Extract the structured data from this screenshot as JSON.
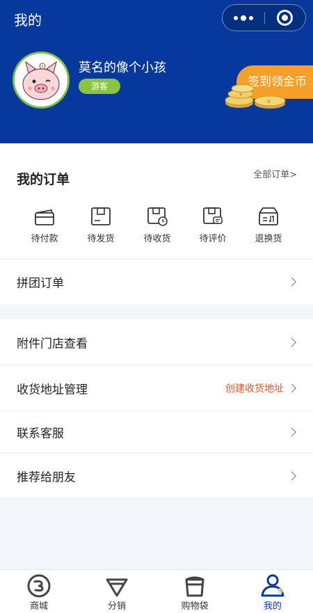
{
  "header": {
    "title": "我的",
    "capsule": {
      "more_icon": "more-dots-icon",
      "close_icon": "target-icon"
    }
  },
  "user": {
    "name": "莫名的像个小孩",
    "role": "游客",
    "avatar_icon": "pig-avatar"
  },
  "signin": {
    "label": "签到领金币"
  },
  "orders": {
    "title": "我的订单",
    "all_label": "全部订单>",
    "items": [
      {
        "label": "待付款",
        "icon": "wallet-icon"
      },
      {
        "label": "待发货",
        "icon": "package-icon"
      },
      {
        "label": "待收货",
        "icon": "box-clock-icon"
      },
      {
        "label": "待评价",
        "icon": "box-comment-icon"
      },
      {
        "label": "退换货",
        "icon": "return-box-icon"
      }
    ]
  },
  "menu": {
    "group_order": "拼团订单",
    "store_view": "附件门店查看",
    "address": "收货地址管理",
    "address_extra": "创建收货地址",
    "service": "联系客服",
    "recommend": "推荐给朋友"
  },
  "tabbar": {
    "items": [
      {
        "label": "商城",
        "icon": "mall-icon"
      },
      {
        "label": "分销",
        "icon": "diamond-icon"
      },
      {
        "label": "购物袋",
        "icon": "bag-icon"
      },
      {
        "label": "我的",
        "icon": "user-icon"
      }
    ],
    "active_index": 3
  },
  "colors": {
    "brand": "#06399b",
    "accent": "#f6a02a",
    "badge": "#8bc53f",
    "link": "#e2552a"
  }
}
